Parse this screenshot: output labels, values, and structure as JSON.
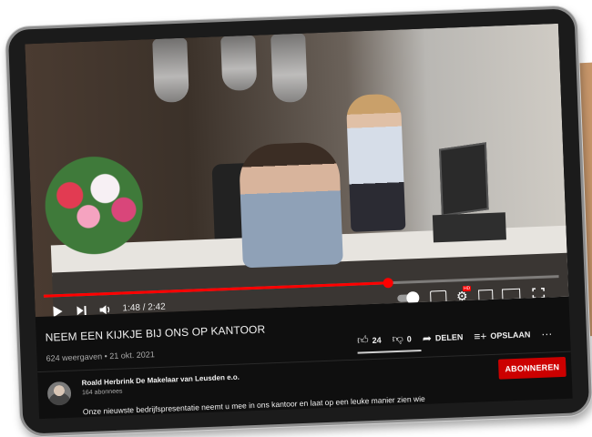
{
  "video": {
    "time_display": "1:48 / 2:42",
    "progress": 0.667
  },
  "title": "NEEM EEN KIJKJE BIJ ONS OP KANTOOR",
  "meta": "624 weergaven • 21 okt. 2021",
  "actions": {
    "likes": "24",
    "dislikes": "0",
    "share": "DELEN",
    "save": "OPSLAAN",
    "more": "···"
  },
  "channel": {
    "name": "Roald Herbrink De Makelaar van Leusden e.o.",
    "subscribers": "164 abonnees",
    "subscribe_label": "ABONNEREN"
  },
  "description": "Onze nieuwste bedrijfspresentatie neemt u mee in ons kantoor en laat op een leuke manier zien wie er bij ons werken.",
  "icons": [
    "play-icon",
    "next-icon",
    "volume-icon",
    "autoplay-toggle",
    "subtitles-icon",
    "settings-icon",
    "miniplayer-icon",
    "theater-icon",
    "fullscreen-icon",
    "like-icon",
    "dislike-icon",
    "share-icon",
    "save-icon",
    "more-icon"
  ],
  "colors": {
    "accent": "#ff0000",
    "subscribe": "#cc0000",
    "background": "#0f0f0f"
  }
}
